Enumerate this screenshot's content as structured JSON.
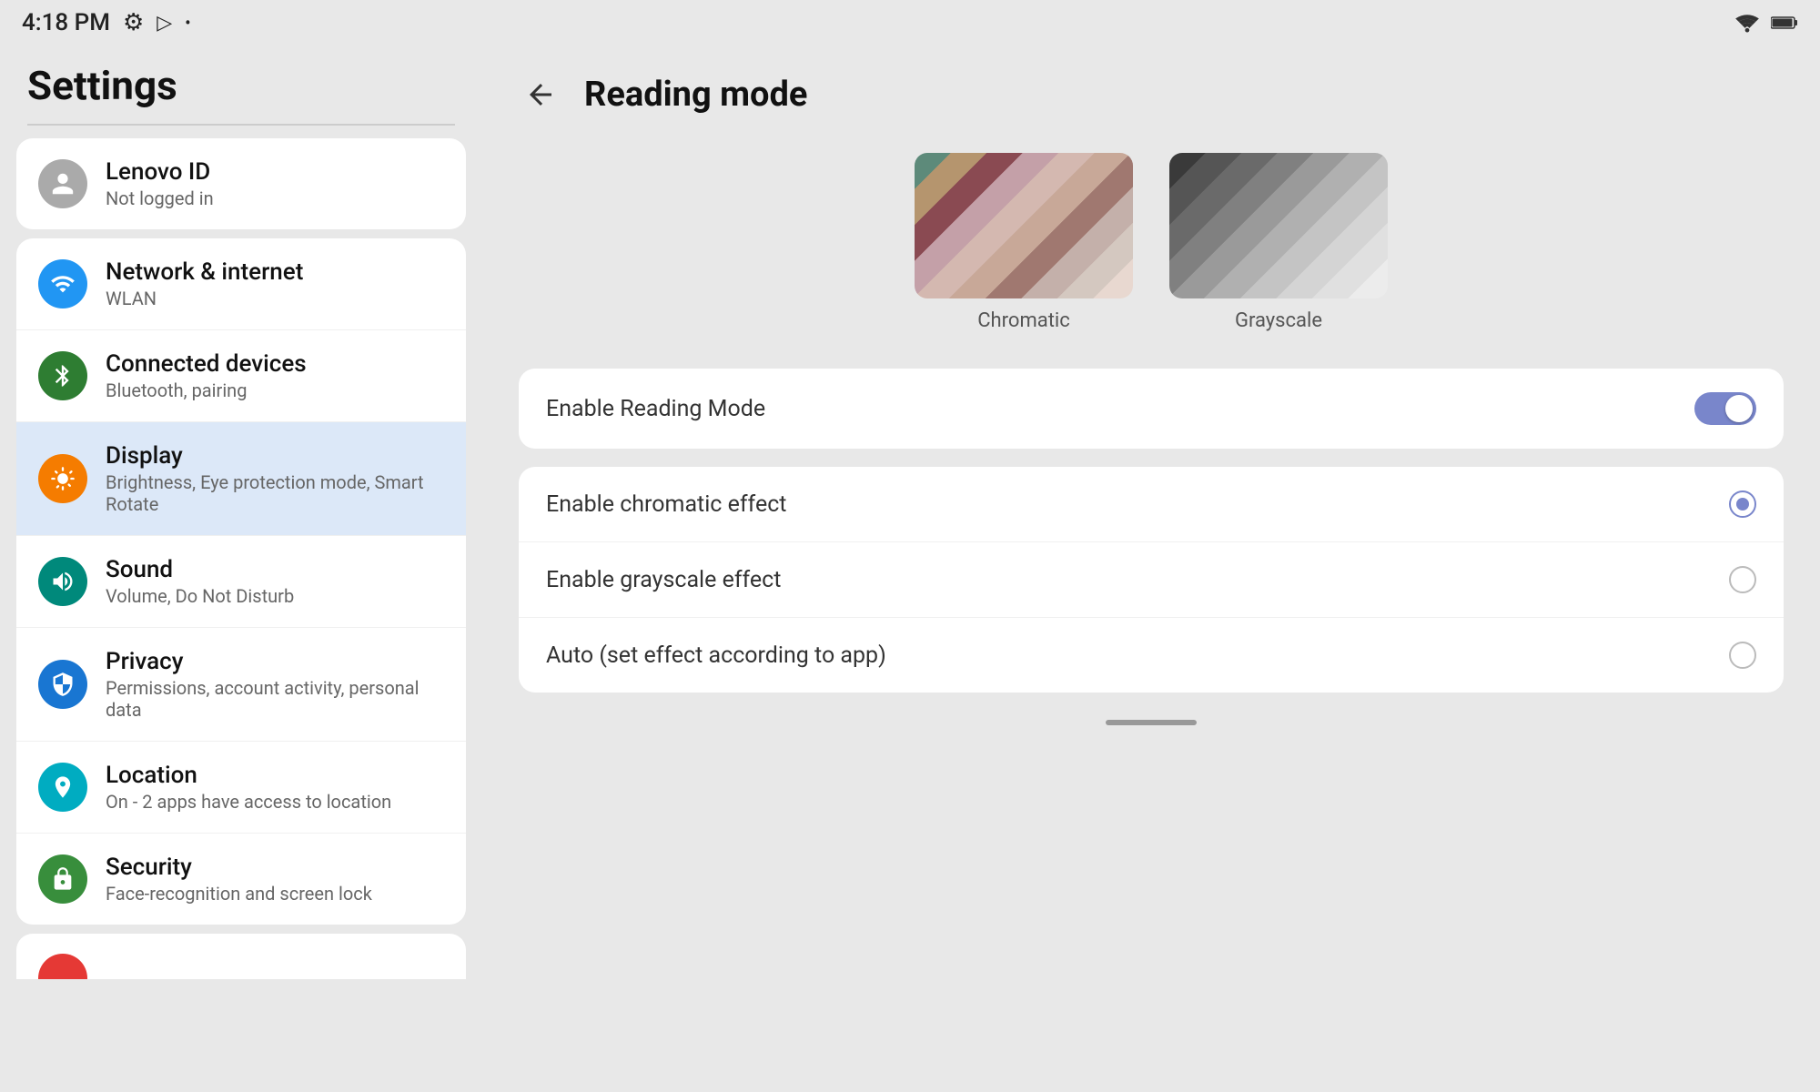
{
  "statusBar": {
    "time": "4:18 PM",
    "wifi": "wifi",
    "battery": "battery"
  },
  "leftPanel": {
    "title": "Settings",
    "lenovo": {
      "name": "Lenovo ID",
      "subtitle": "Not logged in"
    },
    "items": [
      {
        "id": "network",
        "title": "Network & internet",
        "subtitle": "WLAN",
        "iconColor": "icon-blue",
        "active": false
      },
      {
        "id": "connected",
        "title": "Connected devices",
        "subtitle": "Bluetooth, pairing",
        "iconColor": "icon-green-dark",
        "active": false
      },
      {
        "id": "display",
        "title": "Display",
        "subtitle": "Brightness, Eye protection mode, Smart Rotate",
        "iconColor": "icon-orange",
        "active": true
      },
      {
        "id": "sound",
        "title": "Sound",
        "subtitle": "Volume, Do Not Disturb",
        "iconColor": "icon-teal",
        "active": false
      },
      {
        "id": "privacy",
        "title": "Privacy",
        "subtitle": "Permissions, account activity, personal data",
        "iconColor": "icon-blue-mid",
        "active": false
      },
      {
        "id": "location",
        "title": "Location",
        "subtitle": "On - 2 apps have access to location",
        "iconColor": "icon-teal2",
        "active": false
      },
      {
        "id": "security",
        "title": "Security",
        "subtitle": "Face-recognition and screen lock",
        "iconColor": "icon-green2",
        "active": false
      }
    ]
  },
  "rightPanel": {
    "backLabel": "back",
    "title": "Reading mode",
    "chromatic": {
      "label": "Chromatic"
    },
    "grayscale": {
      "label": "Grayscale"
    },
    "enableReadingMode": {
      "label": "Enable Reading Mode",
      "enabled": true
    },
    "options": [
      {
        "id": "chromatic-effect",
        "label": "Enable chromatic effect",
        "selected": true,
        "disabled": false
      },
      {
        "id": "grayscale-effect",
        "label": "Enable grayscale effect",
        "selected": false,
        "disabled": false
      },
      {
        "id": "auto-effect",
        "label": "Auto (set effect according to app)",
        "selected": false,
        "disabled": false
      }
    ]
  }
}
